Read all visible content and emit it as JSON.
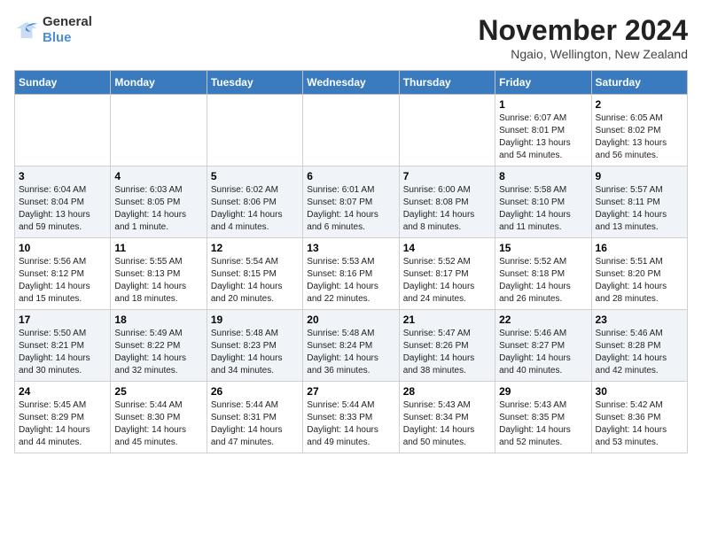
{
  "header": {
    "logo_general": "General",
    "logo_blue": "Blue",
    "month_year": "November 2024",
    "location": "Ngaio, Wellington, New Zealand"
  },
  "days_of_week": [
    "Sunday",
    "Monday",
    "Tuesday",
    "Wednesday",
    "Thursday",
    "Friday",
    "Saturday"
  ],
  "weeks": [
    [
      {
        "day": "",
        "sunrise": "",
        "sunset": "",
        "daylight": ""
      },
      {
        "day": "",
        "sunrise": "",
        "sunset": "",
        "daylight": ""
      },
      {
        "day": "",
        "sunrise": "",
        "sunset": "",
        "daylight": ""
      },
      {
        "day": "",
        "sunrise": "",
        "sunset": "",
        "daylight": ""
      },
      {
        "day": "",
        "sunrise": "",
        "sunset": "",
        "daylight": ""
      },
      {
        "day": "1",
        "sunrise": "Sunrise: 6:07 AM",
        "sunset": "Sunset: 8:01 PM",
        "daylight": "Daylight: 13 hours and 54 minutes."
      },
      {
        "day": "2",
        "sunrise": "Sunrise: 6:05 AM",
        "sunset": "Sunset: 8:02 PM",
        "daylight": "Daylight: 13 hours and 56 minutes."
      }
    ],
    [
      {
        "day": "3",
        "sunrise": "Sunrise: 6:04 AM",
        "sunset": "Sunset: 8:04 PM",
        "daylight": "Daylight: 13 hours and 59 minutes."
      },
      {
        "day": "4",
        "sunrise": "Sunrise: 6:03 AM",
        "sunset": "Sunset: 8:05 PM",
        "daylight": "Daylight: 14 hours and 1 minute."
      },
      {
        "day": "5",
        "sunrise": "Sunrise: 6:02 AM",
        "sunset": "Sunset: 8:06 PM",
        "daylight": "Daylight: 14 hours and 4 minutes."
      },
      {
        "day": "6",
        "sunrise": "Sunrise: 6:01 AM",
        "sunset": "Sunset: 8:07 PM",
        "daylight": "Daylight: 14 hours and 6 minutes."
      },
      {
        "day": "7",
        "sunrise": "Sunrise: 6:00 AM",
        "sunset": "Sunset: 8:08 PM",
        "daylight": "Daylight: 14 hours and 8 minutes."
      },
      {
        "day": "8",
        "sunrise": "Sunrise: 5:58 AM",
        "sunset": "Sunset: 8:10 PM",
        "daylight": "Daylight: 14 hours and 11 minutes."
      },
      {
        "day": "9",
        "sunrise": "Sunrise: 5:57 AM",
        "sunset": "Sunset: 8:11 PM",
        "daylight": "Daylight: 14 hours and 13 minutes."
      }
    ],
    [
      {
        "day": "10",
        "sunrise": "Sunrise: 5:56 AM",
        "sunset": "Sunset: 8:12 PM",
        "daylight": "Daylight: 14 hours and 15 minutes."
      },
      {
        "day": "11",
        "sunrise": "Sunrise: 5:55 AM",
        "sunset": "Sunset: 8:13 PM",
        "daylight": "Daylight: 14 hours and 18 minutes."
      },
      {
        "day": "12",
        "sunrise": "Sunrise: 5:54 AM",
        "sunset": "Sunset: 8:15 PM",
        "daylight": "Daylight: 14 hours and 20 minutes."
      },
      {
        "day": "13",
        "sunrise": "Sunrise: 5:53 AM",
        "sunset": "Sunset: 8:16 PM",
        "daylight": "Daylight: 14 hours and 22 minutes."
      },
      {
        "day": "14",
        "sunrise": "Sunrise: 5:52 AM",
        "sunset": "Sunset: 8:17 PM",
        "daylight": "Daylight: 14 hours and 24 minutes."
      },
      {
        "day": "15",
        "sunrise": "Sunrise: 5:52 AM",
        "sunset": "Sunset: 8:18 PM",
        "daylight": "Daylight: 14 hours and 26 minutes."
      },
      {
        "day": "16",
        "sunrise": "Sunrise: 5:51 AM",
        "sunset": "Sunset: 8:20 PM",
        "daylight": "Daylight: 14 hours and 28 minutes."
      }
    ],
    [
      {
        "day": "17",
        "sunrise": "Sunrise: 5:50 AM",
        "sunset": "Sunset: 8:21 PM",
        "daylight": "Daylight: 14 hours and 30 minutes."
      },
      {
        "day": "18",
        "sunrise": "Sunrise: 5:49 AM",
        "sunset": "Sunset: 8:22 PM",
        "daylight": "Daylight: 14 hours and 32 minutes."
      },
      {
        "day": "19",
        "sunrise": "Sunrise: 5:48 AM",
        "sunset": "Sunset: 8:23 PM",
        "daylight": "Daylight: 14 hours and 34 minutes."
      },
      {
        "day": "20",
        "sunrise": "Sunrise: 5:48 AM",
        "sunset": "Sunset: 8:24 PM",
        "daylight": "Daylight: 14 hours and 36 minutes."
      },
      {
        "day": "21",
        "sunrise": "Sunrise: 5:47 AM",
        "sunset": "Sunset: 8:26 PM",
        "daylight": "Daylight: 14 hours and 38 minutes."
      },
      {
        "day": "22",
        "sunrise": "Sunrise: 5:46 AM",
        "sunset": "Sunset: 8:27 PM",
        "daylight": "Daylight: 14 hours and 40 minutes."
      },
      {
        "day": "23",
        "sunrise": "Sunrise: 5:46 AM",
        "sunset": "Sunset: 8:28 PM",
        "daylight": "Daylight: 14 hours and 42 minutes."
      }
    ],
    [
      {
        "day": "24",
        "sunrise": "Sunrise: 5:45 AM",
        "sunset": "Sunset: 8:29 PM",
        "daylight": "Daylight: 14 hours and 44 minutes."
      },
      {
        "day": "25",
        "sunrise": "Sunrise: 5:44 AM",
        "sunset": "Sunset: 8:30 PM",
        "daylight": "Daylight: 14 hours and 45 minutes."
      },
      {
        "day": "26",
        "sunrise": "Sunrise: 5:44 AM",
        "sunset": "Sunset: 8:31 PM",
        "daylight": "Daylight: 14 hours and 47 minutes."
      },
      {
        "day": "27",
        "sunrise": "Sunrise: 5:44 AM",
        "sunset": "Sunset: 8:33 PM",
        "daylight": "Daylight: 14 hours and 49 minutes."
      },
      {
        "day": "28",
        "sunrise": "Sunrise: 5:43 AM",
        "sunset": "Sunset: 8:34 PM",
        "daylight": "Daylight: 14 hours and 50 minutes."
      },
      {
        "day": "29",
        "sunrise": "Sunrise: 5:43 AM",
        "sunset": "Sunset: 8:35 PM",
        "daylight": "Daylight: 14 hours and 52 minutes."
      },
      {
        "day": "30",
        "sunrise": "Sunrise: 5:42 AM",
        "sunset": "Sunset: 8:36 PM",
        "daylight": "Daylight: 14 hours and 53 minutes."
      }
    ]
  ]
}
